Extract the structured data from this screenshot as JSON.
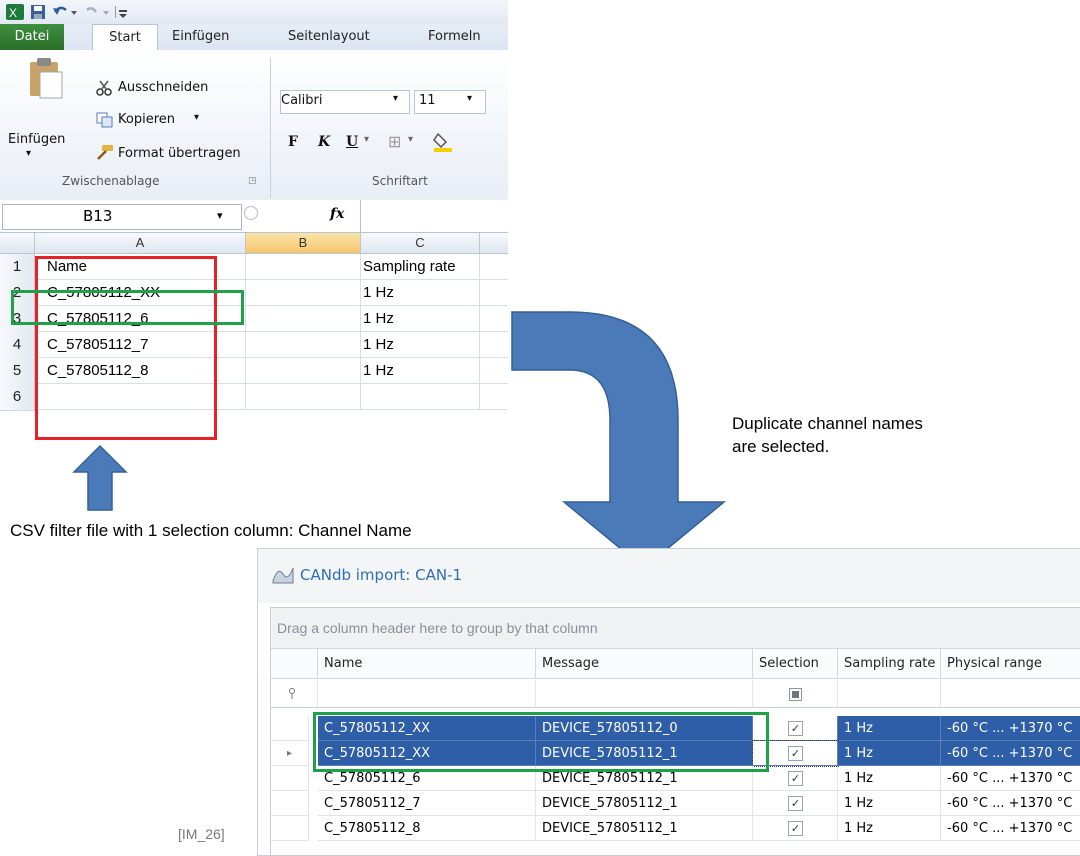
{
  "excel": {
    "tabs": [
      "Datei",
      "Start",
      "Einfügen",
      "Seitenlayout",
      "Formeln"
    ],
    "clipboard": {
      "paste_label": "Einfügen",
      "cut_label": "Ausschneiden",
      "copy_label": "Kopieren",
      "format_painter_label": "Format übertragen",
      "group_label": "Zwischenablage"
    },
    "font": {
      "font_name": "Calibri",
      "font_size": "11",
      "bold": "F",
      "italic": "K",
      "underline": "U",
      "group_label": "Schriftart"
    },
    "name_box": "B13",
    "fx": "fx",
    "columns": [
      "A",
      "B",
      "C"
    ],
    "rows": [
      {
        "num": "1",
        "a": "Name",
        "c": "Sampling rate"
      },
      {
        "num": "2",
        "a": "C_57805112_XX",
        "c": "1 Hz"
      },
      {
        "num": "3",
        "a": "C_57805112_6",
        "c": "1 Hz"
      },
      {
        "num": "4",
        "a": "C_57805112_7",
        "c": "1 Hz"
      },
      {
        "num": "5",
        "a": "C_57805112_8",
        "c": "1 Hz"
      },
      {
        "num": "6",
        "a": "",
        "c": ""
      }
    ]
  },
  "annotations": {
    "csv_note": "CSV filter file with 1 selection column: Channel Name",
    "dup_note_line1": "Duplicate channel names",
    "dup_note_line2": "are selected.",
    "ref": "[IM_26]"
  },
  "colors": {
    "red_box": "#e8202a",
    "green_box": "#1fa14a",
    "arrow": "#4a7ab8",
    "selection": "#2f5ea8"
  },
  "candb": {
    "title": "CANdb import: CAN-1",
    "group_hint": "Drag a column header here to group by that column",
    "headers": [
      "Name",
      "Message",
      "Selection",
      "Sampling rate",
      "Physical range"
    ],
    "rows": [
      {
        "name": "C_57805112_XX",
        "message": "DEVICE_57805112_0",
        "checked": true,
        "rate": "1 Hz",
        "range": "-60 °C ... +1370 °C",
        "selected": true,
        "current": false
      },
      {
        "name": "C_57805112_XX",
        "message": "DEVICE_57805112_1",
        "checked": true,
        "rate": "1 Hz",
        "range": "-60 °C ... +1370 °C",
        "selected": true,
        "current": true
      },
      {
        "name": "C_57805112_6",
        "message": "DEVICE_57805112_1",
        "checked": true,
        "rate": "1 Hz",
        "range": "-60 °C ... +1370 °C",
        "selected": false,
        "current": false
      },
      {
        "name": "C_57805112_7",
        "message": "DEVICE_57805112_1",
        "checked": true,
        "rate": "1 Hz",
        "range": "-60 °C ... +1370 °C",
        "selected": false,
        "current": false
      },
      {
        "name": "C_57805112_8",
        "message": "DEVICE_57805112_1",
        "checked": true,
        "rate": "1 Hz",
        "range": "-60 °C ... +1370 °C",
        "selected": false,
        "current": false
      }
    ]
  }
}
